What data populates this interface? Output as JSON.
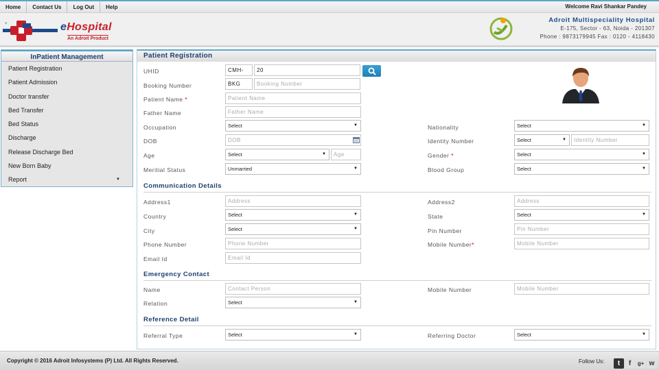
{
  "topnav": {
    "items": [
      "Home",
      "Contact Us",
      "Log Out",
      "Help"
    ],
    "welcome": "Welcome Ravi Shankar Pandey"
  },
  "header": {
    "brand_e": "e",
    "brand_rest": "Hospital",
    "tagline": "An Adroit Product",
    "hospital_name": "Adroit Multispeciality Hospital",
    "address": "E-175, Sector - 63, Noida - 201307",
    "phone": "Phone : 9873179945 Fax : 0120 - 4118430"
  },
  "sidebar": {
    "title": "InPatient Management",
    "items": [
      "Patient Registration",
      "Patient Admission",
      "Doctor transfer",
      "Bed Transfer",
      "Bed Status",
      "Discharge",
      "Release Discharge Bed",
      "New Born Baby",
      "Report"
    ]
  },
  "panel": {
    "title": "Patient Registration"
  },
  "form": {
    "uhid": {
      "label": "UHID",
      "prefix": "CMH-",
      "value": "20"
    },
    "booking": {
      "label": "Booking Number",
      "prefix": "BKG",
      "placeholder": "Booking Number"
    },
    "patient_name": {
      "label": "Patient Name",
      "req": "*",
      "placeholder": "Patient Name"
    },
    "father_name": {
      "label": "Father Name",
      "placeholder": "Father Name"
    },
    "occupation": {
      "label": "Occupation",
      "value": "Select"
    },
    "nationality": {
      "label": "Nationality",
      "value": "Select"
    },
    "dob": {
      "label": "DOB",
      "placeholder": "DOB"
    },
    "identity": {
      "label": "Identity Number",
      "value": "Select",
      "placeholder": "Identity Number"
    },
    "age": {
      "label": "Age",
      "value": "Select",
      "placeholder": "Age"
    },
    "gender": {
      "label": "Gender",
      "req": "*",
      "value": "Select"
    },
    "marital": {
      "label": "Meritial Status",
      "value": "Unmarried"
    },
    "blood": {
      "label": "Blood Group",
      "value": "Select"
    }
  },
  "communication": {
    "title": "Communication Details",
    "address1": {
      "label": "Address1",
      "placeholder": "Address"
    },
    "address2": {
      "label": "Address2",
      "placeholder": "Address"
    },
    "country": {
      "label": "Country",
      "value": "Select"
    },
    "state": {
      "label": "State",
      "value": "Select"
    },
    "city": {
      "label": "City",
      "value": "Select"
    },
    "pin": {
      "label": "Pin Number",
      "placeholder": "Pin Number"
    },
    "phone": {
      "label": "Phone Number",
      "placeholder": "Phone Number"
    },
    "mobile": {
      "label": "Mobile Number",
      "req": "*",
      "placeholder": "Mobile Number"
    },
    "email": {
      "label": "Email Id",
      "placeholder": "Email Id"
    }
  },
  "emergency": {
    "title": "Emergency Contact",
    "name": {
      "label": "Name",
      "placeholder": "Contact Person"
    },
    "mobile": {
      "label": "Mobile Number",
      "placeholder": "Mobile Number"
    },
    "relation": {
      "label": "Relation",
      "value": "Select"
    }
  },
  "reference": {
    "title": "Reference Detail",
    "referral": {
      "label": "Referral Type",
      "value": "Select"
    },
    "doctor": {
      "label": "Referring Doctor",
      "value": "Select"
    }
  },
  "footer": {
    "copyright": "Copyright © 2016 Adroit Infosystems (P) Ltd. All Rights Reserved.",
    "follow": "Follow Us:",
    "social": [
      "t",
      "f",
      "g+",
      "w"
    ]
  }
}
